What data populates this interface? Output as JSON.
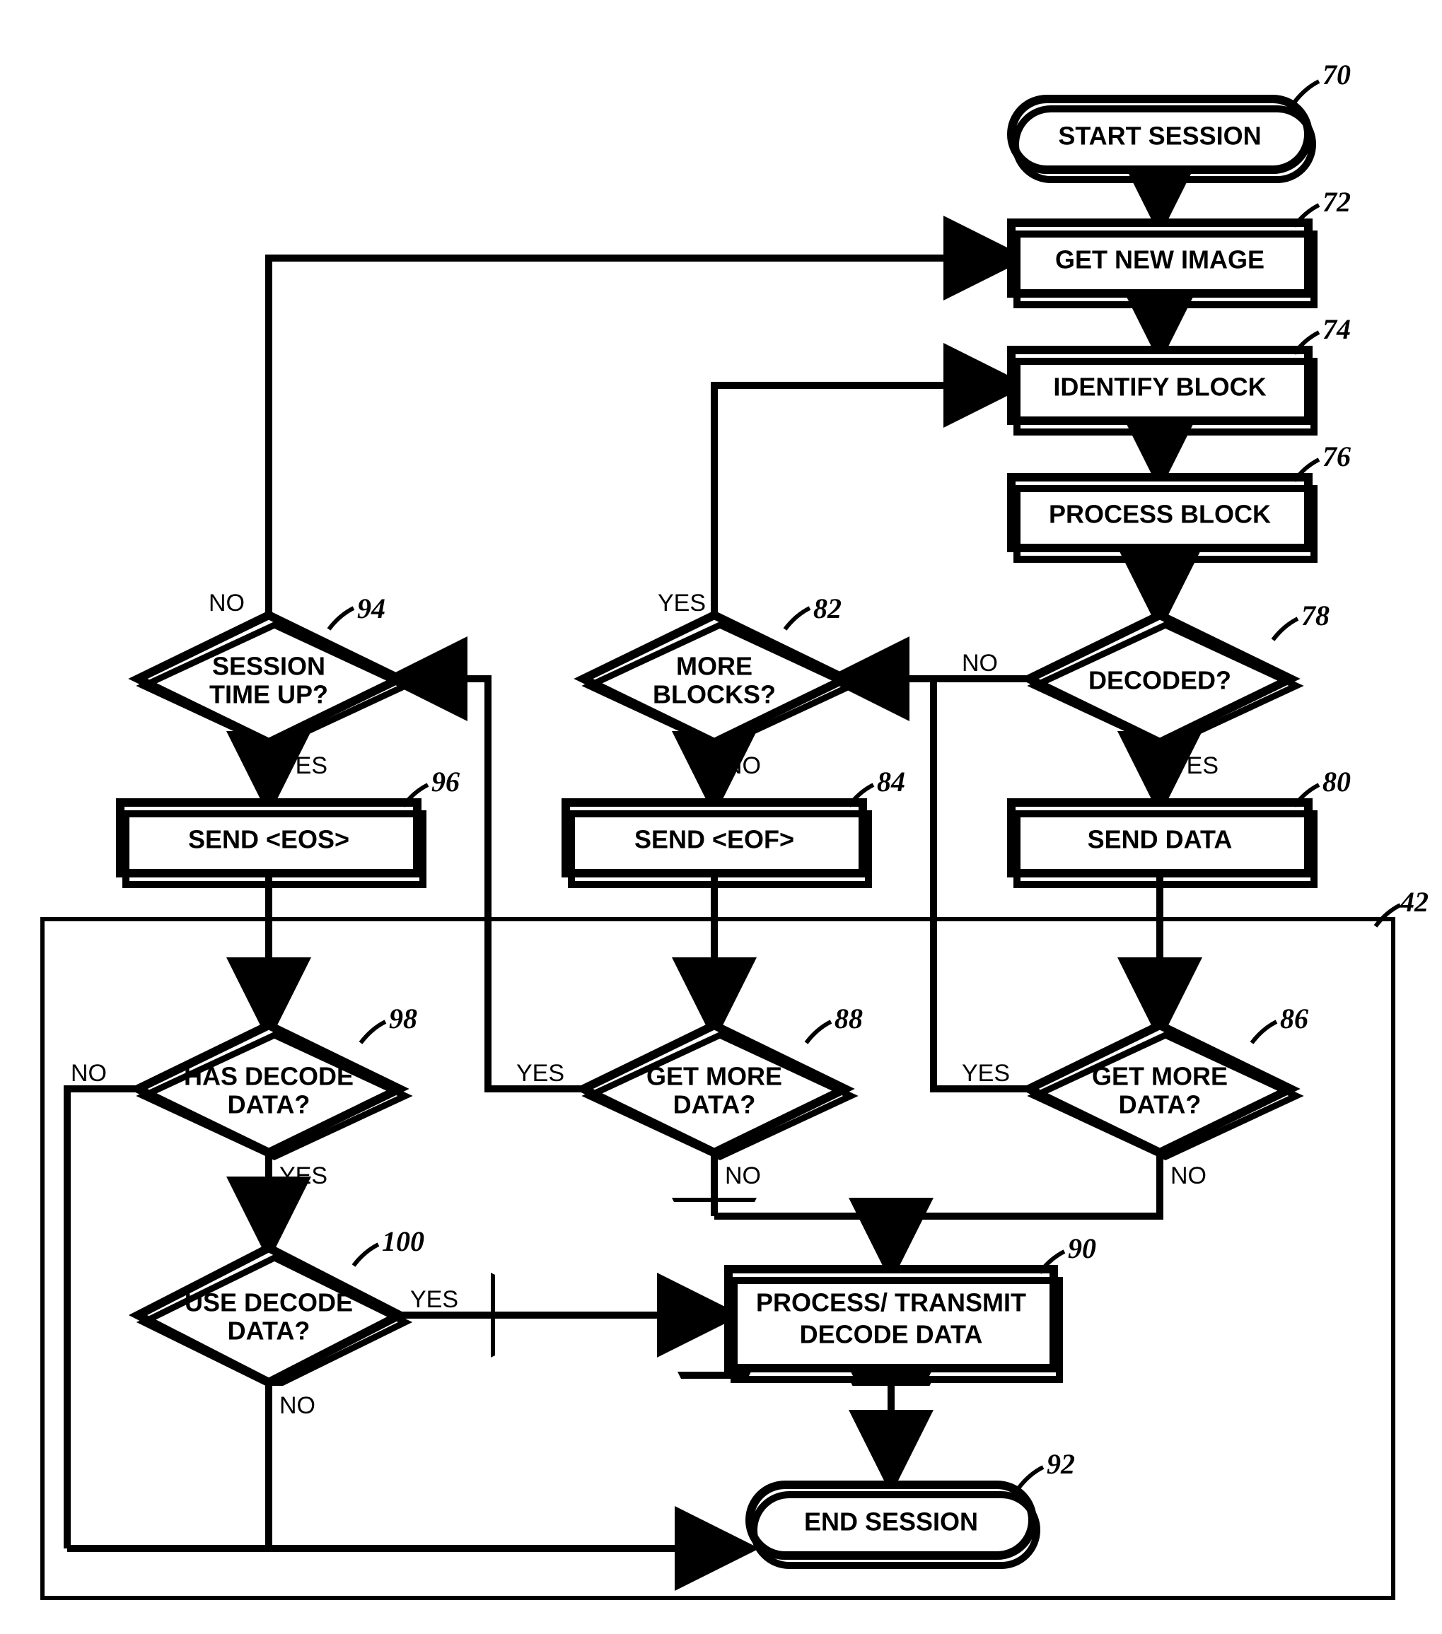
{
  "nodes": {
    "n70": {
      "ref": "70",
      "text": "START SESSION"
    },
    "n72": {
      "ref": "72",
      "text": "GET NEW IMAGE"
    },
    "n74": {
      "ref": "74",
      "text": "IDENTIFY BLOCK"
    },
    "n76": {
      "ref": "76",
      "text": "PROCESS BLOCK"
    },
    "n78": {
      "ref": "78",
      "text": "DECODED?"
    },
    "n80": {
      "ref": "80",
      "text": "SEND DATA"
    },
    "n82": {
      "ref": "82",
      "text": [
        "MORE",
        "BLOCKS?"
      ]
    },
    "n84": {
      "ref": "84",
      "text": "SEND <EOF>"
    },
    "n86": {
      "ref": "86",
      "text": [
        "GET MORE",
        "DATA?"
      ]
    },
    "n88": {
      "ref": "88",
      "text": [
        "GET MORE",
        "DATA?"
      ]
    },
    "n90": {
      "ref": "90",
      "text": [
        "PROCESS/ TRANSMIT",
        "DECODE DATA"
      ]
    },
    "n92": {
      "ref": "92",
      "text": "END SESSION"
    },
    "n94": {
      "ref": "94",
      "text": [
        "SESSION",
        "TIME UP?"
      ]
    },
    "n96": {
      "ref": "96",
      "text": "SEND <EOS>"
    },
    "n98": {
      "ref": "98",
      "text": [
        "HAS DECODE",
        "DATA?"
      ]
    },
    "n100": {
      "ref": "100",
      "text": [
        "USE DECODE",
        "DATA?"
      ]
    }
  },
  "container_ref": "42",
  "labels": {
    "yes": "YES",
    "no": "NO"
  }
}
